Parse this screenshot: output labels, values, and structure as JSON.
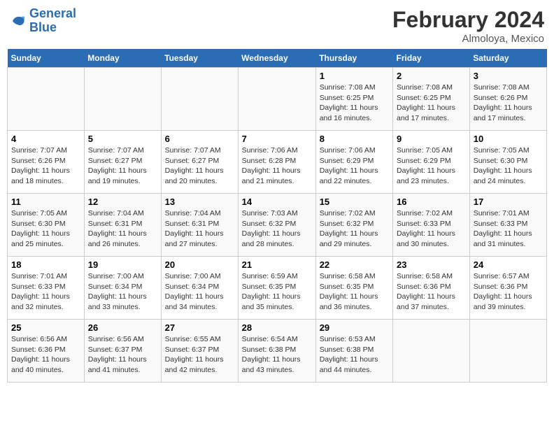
{
  "header": {
    "logo_line1": "General",
    "logo_line2": "Blue",
    "month_year": "February 2024",
    "location": "Almoloya, Mexico"
  },
  "days_of_week": [
    "Sunday",
    "Monday",
    "Tuesday",
    "Wednesday",
    "Thursday",
    "Friday",
    "Saturday"
  ],
  "weeks": [
    [
      {
        "day": "",
        "info": ""
      },
      {
        "day": "",
        "info": ""
      },
      {
        "day": "",
        "info": ""
      },
      {
        "day": "",
        "info": ""
      },
      {
        "day": "1",
        "info": "Sunrise: 7:08 AM\nSunset: 6:25 PM\nDaylight: 11 hours and 16 minutes."
      },
      {
        "day": "2",
        "info": "Sunrise: 7:08 AM\nSunset: 6:25 PM\nDaylight: 11 hours and 17 minutes."
      },
      {
        "day": "3",
        "info": "Sunrise: 7:08 AM\nSunset: 6:26 PM\nDaylight: 11 hours and 17 minutes."
      }
    ],
    [
      {
        "day": "4",
        "info": "Sunrise: 7:07 AM\nSunset: 6:26 PM\nDaylight: 11 hours and 18 minutes."
      },
      {
        "day": "5",
        "info": "Sunrise: 7:07 AM\nSunset: 6:27 PM\nDaylight: 11 hours and 19 minutes."
      },
      {
        "day": "6",
        "info": "Sunrise: 7:07 AM\nSunset: 6:27 PM\nDaylight: 11 hours and 20 minutes."
      },
      {
        "day": "7",
        "info": "Sunrise: 7:06 AM\nSunset: 6:28 PM\nDaylight: 11 hours and 21 minutes."
      },
      {
        "day": "8",
        "info": "Sunrise: 7:06 AM\nSunset: 6:29 PM\nDaylight: 11 hours and 22 minutes."
      },
      {
        "day": "9",
        "info": "Sunrise: 7:05 AM\nSunset: 6:29 PM\nDaylight: 11 hours and 23 minutes."
      },
      {
        "day": "10",
        "info": "Sunrise: 7:05 AM\nSunset: 6:30 PM\nDaylight: 11 hours and 24 minutes."
      }
    ],
    [
      {
        "day": "11",
        "info": "Sunrise: 7:05 AM\nSunset: 6:30 PM\nDaylight: 11 hours and 25 minutes."
      },
      {
        "day": "12",
        "info": "Sunrise: 7:04 AM\nSunset: 6:31 PM\nDaylight: 11 hours and 26 minutes."
      },
      {
        "day": "13",
        "info": "Sunrise: 7:04 AM\nSunset: 6:31 PM\nDaylight: 11 hours and 27 minutes."
      },
      {
        "day": "14",
        "info": "Sunrise: 7:03 AM\nSunset: 6:32 PM\nDaylight: 11 hours and 28 minutes."
      },
      {
        "day": "15",
        "info": "Sunrise: 7:02 AM\nSunset: 6:32 PM\nDaylight: 11 hours and 29 minutes."
      },
      {
        "day": "16",
        "info": "Sunrise: 7:02 AM\nSunset: 6:33 PM\nDaylight: 11 hours and 30 minutes."
      },
      {
        "day": "17",
        "info": "Sunrise: 7:01 AM\nSunset: 6:33 PM\nDaylight: 11 hours and 31 minutes."
      }
    ],
    [
      {
        "day": "18",
        "info": "Sunrise: 7:01 AM\nSunset: 6:33 PM\nDaylight: 11 hours and 32 minutes."
      },
      {
        "day": "19",
        "info": "Sunrise: 7:00 AM\nSunset: 6:34 PM\nDaylight: 11 hours and 33 minutes."
      },
      {
        "day": "20",
        "info": "Sunrise: 7:00 AM\nSunset: 6:34 PM\nDaylight: 11 hours and 34 minutes."
      },
      {
        "day": "21",
        "info": "Sunrise: 6:59 AM\nSunset: 6:35 PM\nDaylight: 11 hours and 35 minutes."
      },
      {
        "day": "22",
        "info": "Sunrise: 6:58 AM\nSunset: 6:35 PM\nDaylight: 11 hours and 36 minutes."
      },
      {
        "day": "23",
        "info": "Sunrise: 6:58 AM\nSunset: 6:36 PM\nDaylight: 11 hours and 37 minutes."
      },
      {
        "day": "24",
        "info": "Sunrise: 6:57 AM\nSunset: 6:36 PM\nDaylight: 11 hours and 39 minutes."
      }
    ],
    [
      {
        "day": "25",
        "info": "Sunrise: 6:56 AM\nSunset: 6:36 PM\nDaylight: 11 hours and 40 minutes."
      },
      {
        "day": "26",
        "info": "Sunrise: 6:56 AM\nSunset: 6:37 PM\nDaylight: 11 hours and 41 minutes."
      },
      {
        "day": "27",
        "info": "Sunrise: 6:55 AM\nSunset: 6:37 PM\nDaylight: 11 hours and 42 minutes."
      },
      {
        "day": "28",
        "info": "Sunrise: 6:54 AM\nSunset: 6:38 PM\nDaylight: 11 hours and 43 minutes."
      },
      {
        "day": "29",
        "info": "Sunrise: 6:53 AM\nSunset: 6:38 PM\nDaylight: 11 hours and 44 minutes."
      },
      {
        "day": "",
        "info": ""
      },
      {
        "day": "",
        "info": ""
      }
    ]
  ]
}
